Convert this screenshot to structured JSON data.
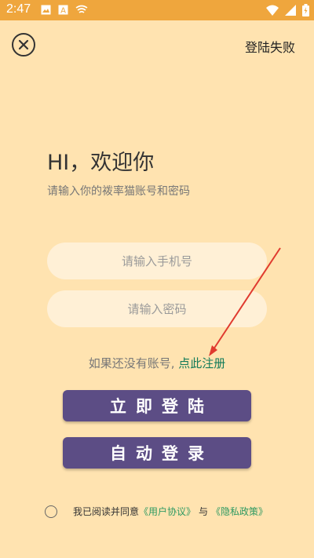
{
  "status_bar": {
    "time": "2:47",
    "icons_left": [
      "image-icon",
      "a-icon",
      "wifi-signal-icon"
    ],
    "icons_right": [
      "wifi-icon",
      "cell-signal-icon",
      "battery-icon"
    ],
    "bg_color": "#efa63d"
  },
  "header": {
    "close_icon": "close-circle-icon",
    "status_text": "登陆失败"
  },
  "main": {
    "greeting": "HI，欢迎你",
    "subtitle": "请输入你的袯率猫账号和密码",
    "phone_placeholder": "请输入手机号",
    "password_placeholder": "请输入密码",
    "register_prompt": "如果还没有账号,",
    "register_link": "点此注册",
    "login_button": "立即登陆",
    "auto_login_button": "自动登录"
  },
  "agreement": {
    "prefix": "我已阅读并同意",
    "user_agreement": "《用户协议》",
    "conjunction": "与",
    "privacy_policy": "《隐私政策》"
  },
  "colors": {
    "background": "#ffe3b0",
    "button": "#5c4d85",
    "link": "#117b59",
    "annotation_arrow": "#e03a2f"
  }
}
